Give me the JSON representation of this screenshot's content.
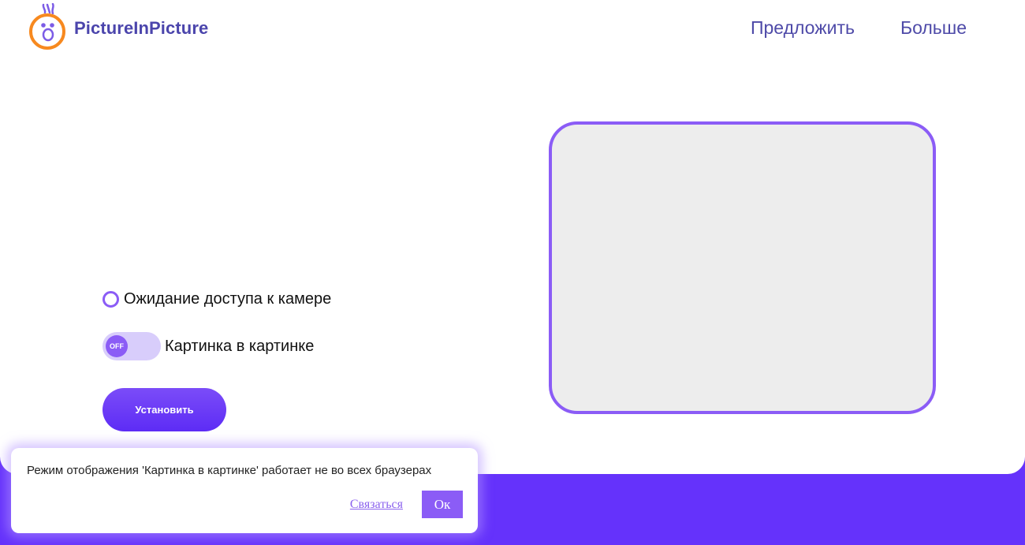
{
  "header": {
    "brand": "PictureInPicture",
    "nav": [
      {
        "label": "Предложить"
      },
      {
        "label": "Больше"
      }
    ]
  },
  "main": {
    "camera_status": "Ожидание доступа к камере",
    "toggle": {
      "state_label": "OFF",
      "label": "Картинка в картинке"
    },
    "install_label": "Установить"
  },
  "notice": {
    "text": "Режим отображения 'Картинка в картинке' работает не во всех браузерах",
    "contact_label": "Связаться",
    "ok_label": "Ок"
  },
  "colors": {
    "accent": "#8b5cf6",
    "brand_text": "#4b45ac",
    "footer": "#6532fb",
    "preview_bg": "#ededed"
  }
}
